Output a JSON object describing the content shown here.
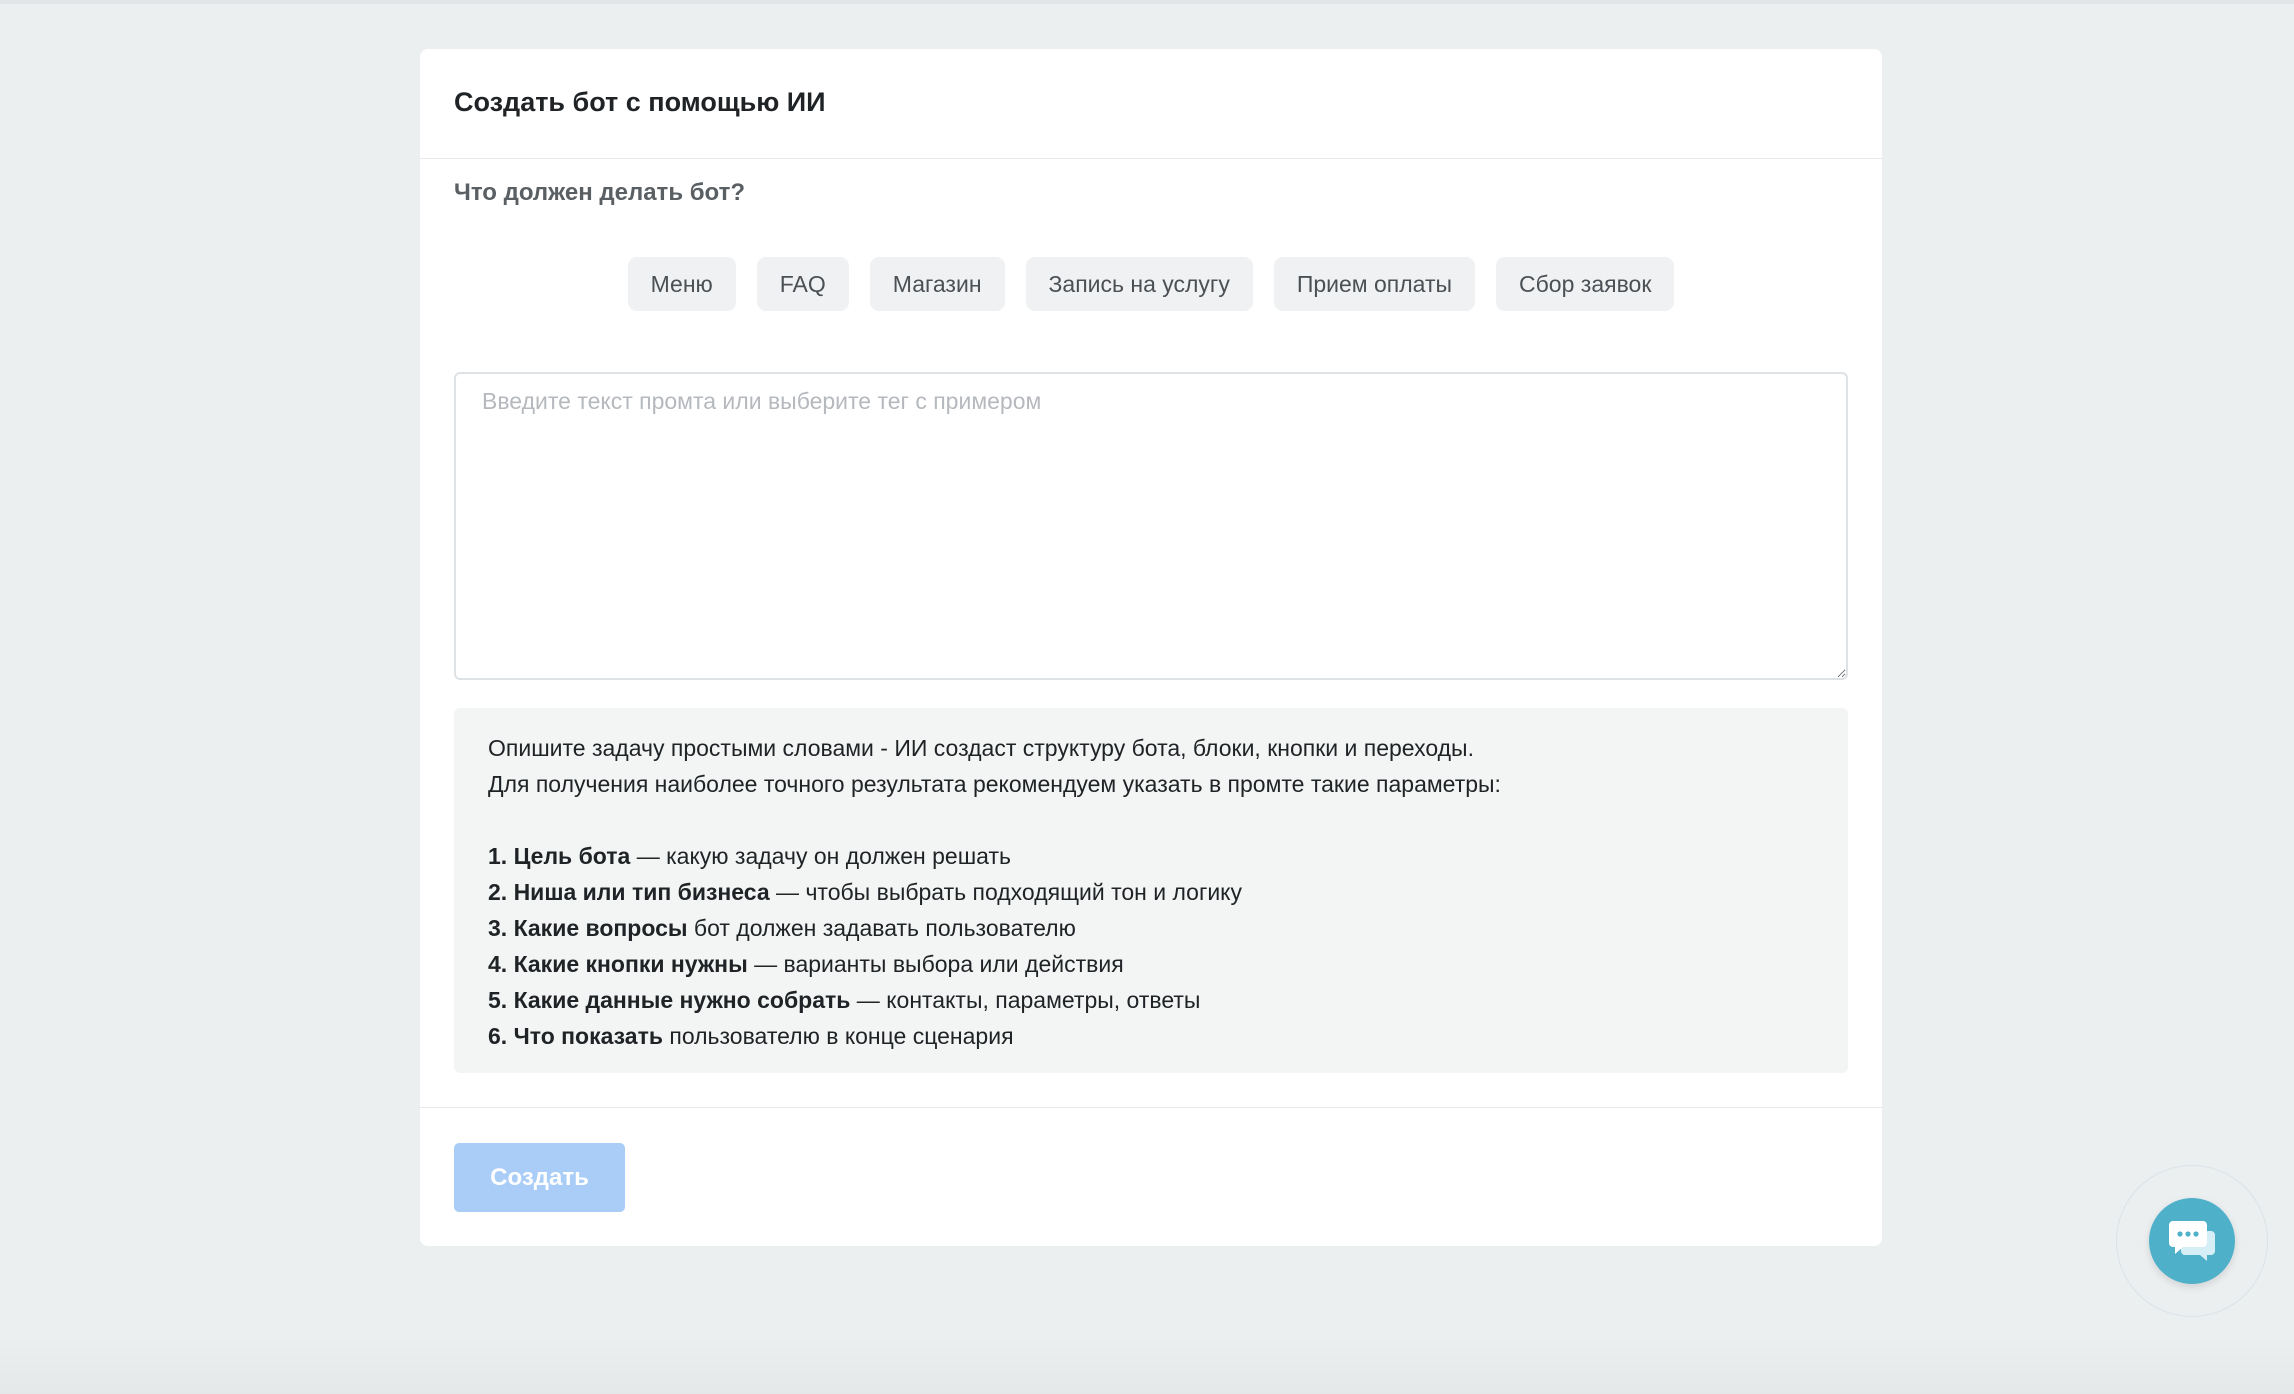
{
  "card": {
    "title": "Создать бот с помощью ИИ",
    "question": "Что должен делать бот?",
    "tags": [
      "Меню",
      "FAQ",
      "Магазин",
      "Запись на услугу",
      "Прием оплаты",
      "Сбор заявок"
    ],
    "prompt": {
      "value": "",
      "placeholder": "Введите текст промта или выберите тег с примером"
    },
    "hint": {
      "line1": "Опишите задачу простыми словами - ИИ создаст структуру бота, блоки, кнопки и переходы.",
      "line2": "Для получения наиболее точного результата рекомендуем указать в промте такие параметры:",
      "items": [
        {
          "bold": "1. Цель бота",
          "text": " — какую задачу он должен решать"
        },
        {
          "bold": "2. Ниша или тип бизнеса",
          "text": " — чтобы выбрать подходящий тон и логику"
        },
        {
          "bold": "3. Какие вопросы",
          "text": " бот должен задавать пользователю"
        },
        {
          "bold": "4. Какие кнопки нужны",
          "text": " — варианты выбора или действия"
        },
        {
          "bold": "5. Какие данные нужно собрать",
          "text": " — контакты, параметры, ответы"
        },
        {
          "bold": "6. Что показать",
          "text": " пользователю в конце сценария"
        }
      ]
    },
    "create_label": "Создать"
  },
  "chat_widget": {
    "icon": "chat-bubbles-icon"
  },
  "colors": {
    "background": "#eceff0",
    "card": "#ffffff",
    "tag_bg": "#f0f1f2",
    "hint_bg": "#f3f4f4",
    "button_disabled": "#a9cdf7",
    "chat_accent": "#4fb0c9"
  }
}
